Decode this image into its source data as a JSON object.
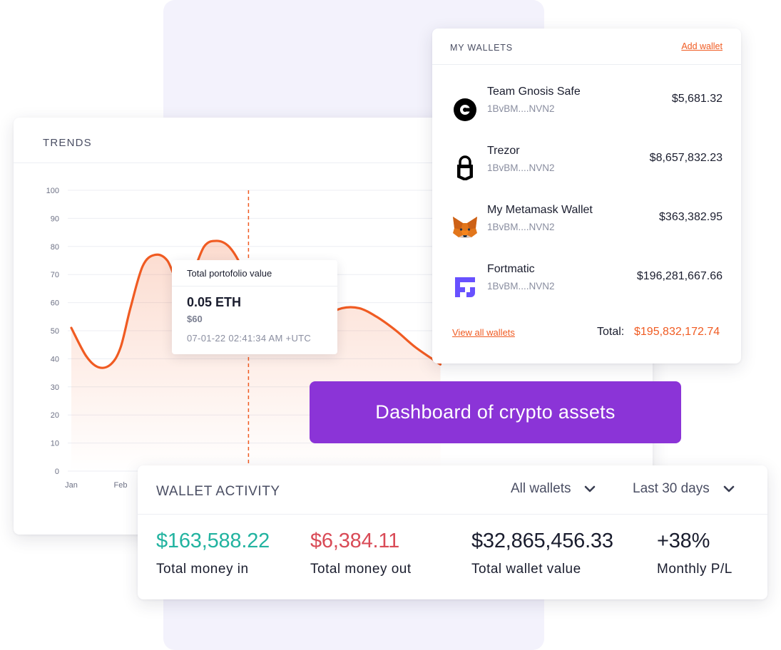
{
  "banner": "Dashboard of crypto assets",
  "trends": {
    "title": "TRENDS",
    "tooltip": {
      "title": "Total portofolio value",
      "eth": "0.05 ETH",
      "usd": "$60",
      "timestamp": "07-01-22   02:41:34 AM +UTC"
    }
  },
  "chart_data": {
    "type": "area",
    "title": "",
    "xlabel": "",
    "ylabel": "",
    "ylim": [
      0,
      100
    ],
    "y_ticks": [
      "100",
      "90",
      "80",
      "70",
      "60",
      "50",
      "40",
      "30",
      "20",
      "10",
      "0"
    ],
    "x_ticks": [
      "Jan",
      "Feb"
    ],
    "series": [
      {
        "x": [
          0,
          0.3,
          0.55,
          0.8,
          1.0,
          1.2,
          1.45,
          1.7,
          1.95,
          2.2,
          2.45,
          2.7,
          2.95,
          3.2,
          3.45,
          3.7,
          3.95,
          4.25,
          4.55,
          4.85,
          5.15,
          5.5,
          5.85,
          6.2,
          6.6,
          7.0,
          7.5
        ],
        "values": [
          51,
          41,
          37,
          38,
          44,
          58,
          73,
          77,
          75,
          66,
          70,
          80,
          82,
          80,
          73,
          61,
          51,
          46,
          46,
          50,
          55,
          58,
          58,
          55,
          50,
          44,
          38
        ]
      }
    ],
    "highlight": {
      "x": 3.6,
      "y": 73
    },
    "line_color": "#f05b22",
    "grid": true
  },
  "wallets": {
    "title": "MY WALLETS",
    "add_label": "Add wallet",
    "items": [
      {
        "name": "Team Gnosis Safe",
        "address": "1BvBM....NVN2",
        "value": "$5,681.32",
        "icon": "gnosis-icon"
      },
      {
        "name": "Trezor",
        "address": "1BvBM....NVN2",
        "value": "$8,657,832.23",
        "icon": "lock-icon"
      },
      {
        "name": "My Metamask Wallet",
        "address": "1BvBM....NVN2",
        "value": "$363,382.95",
        "icon": "fox-icon"
      },
      {
        "name": "Fortmatic",
        "address": "1BvBM....NVN2",
        "value": "$196,281,667.66",
        "icon": "fortmatic-icon"
      }
    ],
    "view_all": "View all wallets",
    "total_label": "Total:",
    "total_value": "$195,832,172.74"
  },
  "activity": {
    "title": "WALLET ACTIVITY",
    "filter_wallets": "All wallets",
    "filter_period": "Last 30 days",
    "stats": [
      {
        "value": "$163,588.22",
        "label": "Total money in",
        "color": "#22b3a0"
      },
      {
        "value": "$6,384.11",
        "label": "Total money out",
        "color": "#d94b57"
      },
      {
        "value": "$32,865,456.33",
        "label": "Total wallet value",
        "color": "#1a1d2e"
      },
      {
        "value": "+38%",
        "label": "Monthly P/L",
        "color": "#1a1d2e"
      }
    ]
  }
}
